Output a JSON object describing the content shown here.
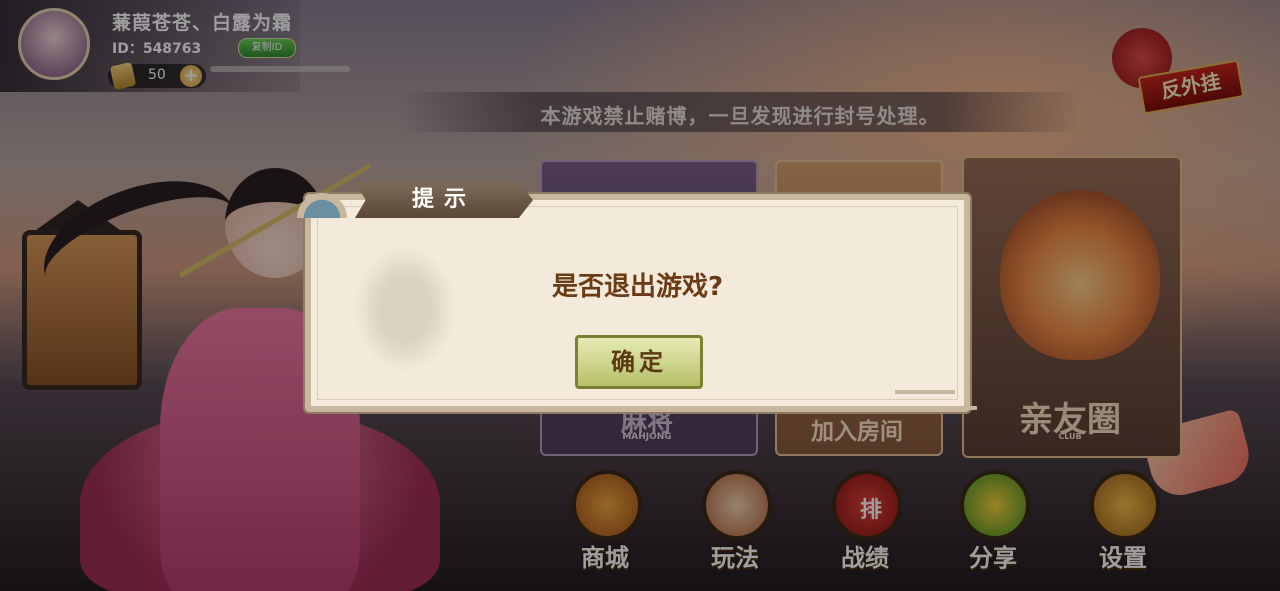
{
  "profile": {
    "nickname": "蒹葭苍苍、白露为霜",
    "id_text": "ID：548763",
    "copy_id_label": "复制ID",
    "coins": "50",
    "add_label": "+"
  },
  "notice": "本游戏禁止赌博，一旦发现进行封号处理。",
  "seal_label": "反外挂",
  "cards": {
    "mahjong": {
      "label": "麻将",
      "sub": "MAHJONG"
    },
    "join": {
      "label": "加入房间"
    },
    "club": {
      "label": "亲友圈",
      "sub": "CLUB"
    }
  },
  "nav": [
    {
      "label": "商城",
      "icon": "shop-icon"
    },
    {
      "label": "玩法",
      "icon": "scroll-icon"
    },
    {
      "label": "战绩",
      "icon": "rank-icon",
      "symbol": "排"
    },
    {
      "label": "分享",
      "icon": "chat-icon"
    },
    {
      "label": "设置",
      "icon": "gear-icon"
    }
  ],
  "modal": {
    "title": "提示",
    "message": "是否退出游戏?",
    "confirm_label": "确定"
  }
}
